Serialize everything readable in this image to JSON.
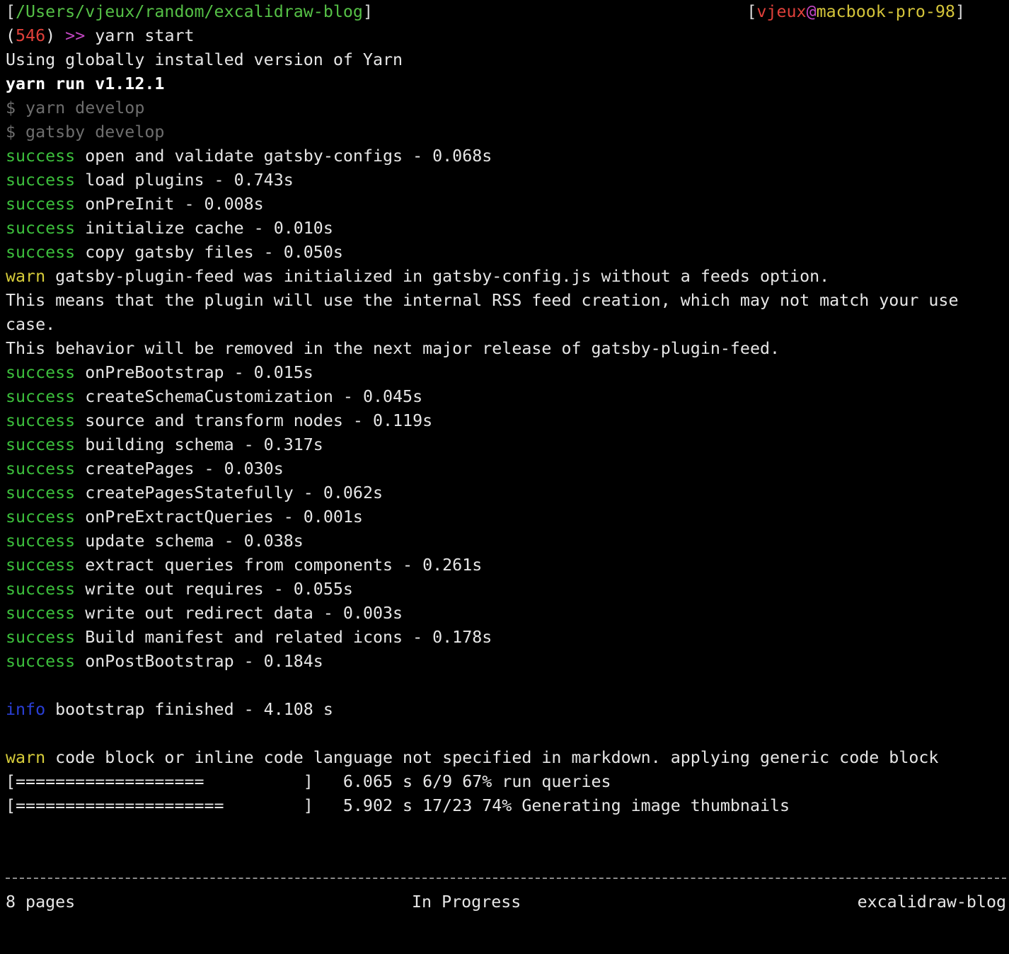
{
  "colors": {
    "background": "#000000",
    "default": "#e6e6e6",
    "bold": "#ffffff",
    "bracket": "#d8d8d8",
    "path": "#55c046",
    "user": "#e0403a",
    "host": "#d4c43a",
    "prompt_count": "#e0403a",
    "prompt_arrows": "#c347c3",
    "dim": "#6e6e6e",
    "success": "#3cbf3c",
    "warn": "#d6cc3a",
    "info": "#2a3fd6"
  },
  "header": {
    "left": [
      {
        "text": "[",
        "color": "bracket"
      },
      {
        "text": "/Users/vjeux/random/excalidraw-blog",
        "color": "path"
      },
      {
        "text": "]",
        "color": "bracket"
      }
    ],
    "right": [
      {
        "text": "[",
        "color": "bracket"
      },
      {
        "text": "vjeux",
        "color": "user"
      },
      {
        "text": "@",
        "color": "prompt_arrows"
      },
      {
        "text": "macbook-pro-98",
        "color": "host"
      },
      {
        "text": "]",
        "color": "bracket"
      }
    ]
  },
  "lines": [
    [
      {
        "text": "(",
        "color": "default"
      },
      {
        "text": "546",
        "color": "prompt_count"
      },
      {
        "text": ") ",
        "color": "default"
      },
      {
        "text": ">>",
        "color": "prompt_arrows"
      },
      {
        "text": " yarn start",
        "color": "default"
      }
    ],
    [
      {
        "text": "Using globally installed version of Yarn",
        "color": "default"
      }
    ],
    [
      {
        "text": "yarn run v1.12.1",
        "color": "bold",
        "bold": true
      }
    ],
    [
      {
        "text": "$ yarn develop",
        "color": "dim"
      }
    ],
    [
      {
        "text": "$ gatsby develop",
        "color": "dim"
      }
    ],
    [
      {
        "text": "success",
        "color": "success"
      },
      {
        "text": " open and validate gatsby-configs - 0.068s",
        "color": "default"
      }
    ],
    [
      {
        "text": "success",
        "color": "success"
      },
      {
        "text": " load plugins - 0.743s",
        "color": "default"
      }
    ],
    [
      {
        "text": "success",
        "color": "success"
      },
      {
        "text": " onPreInit - 0.008s",
        "color": "default"
      }
    ],
    [
      {
        "text": "success",
        "color": "success"
      },
      {
        "text": " initialize cache - 0.010s",
        "color": "default"
      }
    ],
    [
      {
        "text": "success",
        "color": "success"
      },
      {
        "text": " copy gatsby files - 0.050s",
        "color": "default"
      }
    ],
    [
      {
        "text": "warn",
        "color": "warn"
      },
      {
        "text": " gatsby-plugin-feed was initialized in gatsby-config.js without a feeds option.",
        "color": "default"
      }
    ],
    [
      {
        "text": "This means that the plugin will use the internal RSS feed creation, which may not match your use",
        "color": "default"
      }
    ],
    [
      {
        "text": "case.",
        "color": "default"
      }
    ],
    [
      {
        "text": "This behavior will be removed in the next major release of gatsby-plugin-feed.",
        "color": "default"
      }
    ],
    [
      {
        "text": "success",
        "color": "success"
      },
      {
        "text": " onPreBootstrap - 0.015s",
        "color": "default"
      }
    ],
    [
      {
        "text": "success",
        "color": "success"
      },
      {
        "text": " createSchemaCustomization - 0.045s",
        "color": "default"
      }
    ],
    [
      {
        "text": "success",
        "color": "success"
      },
      {
        "text": " source and transform nodes - 0.119s",
        "color": "default"
      }
    ],
    [
      {
        "text": "success",
        "color": "success"
      },
      {
        "text": " building schema - 0.317s",
        "color": "default"
      }
    ],
    [
      {
        "text": "success",
        "color": "success"
      },
      {
        "text": " createPages - 0.030s",
        "color": "default"
      }
    ],
    [
      {
        "text": "success",
        "color": "success"
      },
      {
        "text": " createPagesStatefully - 0.062s",
        "color": "default"
      }
    ],
    [
      {
        "text": "success",
        "color": "success"
      },
      {
        "text": " onPreExtractQueries - 0.001s",
        "color": "default"
      }
    ],
    [
      {
        "text": "success",
        "color": "success"
      },
      {
        "text": " update schema - 0.038s",
        "color": "default"
      }
    ],
    [
      {
        "text": "success",
        "color": "success"
      },
      {
        "text": " extract queries from components - 0.261s",
        "color": "default"
      }
    ],
    [
      {
        "text": "success",
        "color": "success"
      },
      {
        "text": " write out requires - 0.055s",
        "color": "default"
      }
    ],
    [
      {
        "text": "success",
        "color": "success"
      },
      {
        "text": " write out redirect data - 0.003s",
        "color": "default"
      }
    ],
    [
      {
        "text": "success",
        "color": "success"
      },
      {
        "text": " Build manifest and related icons - 0.178s",
        "color": "default"
      }
    ],
    [
      {
        "text": "success",
        "color": "success"
      },
      {
        "text": " onPostBootstrap - 0.184s",
        "color": "default"
      }
    ],
    [],
    [
      {
        "text": "info",
        "color": "info"
      },
      {
        "text": " bootstrap finished - 4.108 s",
        "color": "default"
      }
    ],
    [],
    [
      {
        "text": "warn",
        "color": "warn"
      },
      {
        "text": " code block or inline code language not specified in markdown. applying generic code block",
        "color": "default"
      }
    ],
    [
      {
        "text": "[===================          ]   6.065 s 6/9 67% run queries",
        "color": "default"
      }
    ],
    [
      {
        "text": "[=====================        ]   5.902 s 17/23 74% Generating image thumbnails",
        "color": "default"
      }
    ]
  ],
  "status_bar": {
    "left": "8 pages",
    "center": "In Progress",
    "right": "excalidraw-blog"
  }
}
